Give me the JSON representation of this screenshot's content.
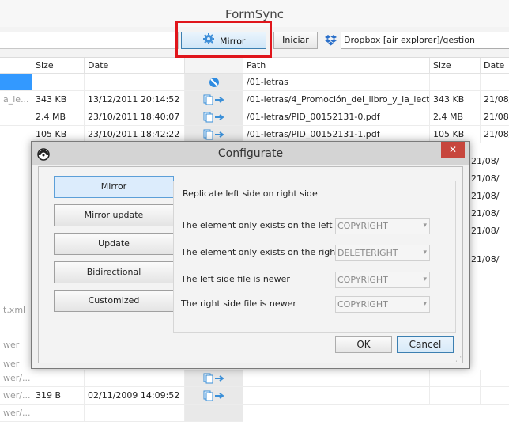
{
  "app": {
    "title": "FormSync"
  },
  "toolbar": {
    "mirror_label": "Mirror",
    "iniciar_label": "Iniciar",
    "right_path": "Dropbox [air explorer]/gestion"
  },
  "grid": {
    "left_headers": [
      "Size",
      "Date"
    ],
    "right_headers": [
      "Path",
      "Size",
      "Date"
    ],
    "rows": [
      {
        "left_name": "",
        "left_size": "",
        "left_date": "",
        "path": "/01-letras",
        "right_size": "",
        "right_date": "",
        "action": "skip"
      },
      {
        "left_name": "a_le...",
        "left_size": "343 KB",
        "left_date": "13/12/2011 20:14:52",
        "path": "/01-letras/4_Promoción_del_libro_y_la_lectur...",
        "right_size": "343 KB",
        "right_date": "21/08/",
        "action": "copy"
      },
      {
        "left_name": "",
        "left_size": "2,4 MB",
        "left_date": "23/10/2011 18:40:07",
        "path": "/01-letras/PID_00152131-0.pdf",
        "right_size": "2,4 MB",
        "right_date": "21/08/",
        "action": "copy"
      },
      {
        "left_name": "",
        "left_size": "105 KB",
        "left_date": "23/10/2011 18:42:22",
        "path": "/01-letras/PID_00152131-1.pdf",
        "right_size": "105 KB",
        "right_date": "21/08/",
        "action": "copy"
      }
    ],
    "partial_right_dates": [
      "21/08/",
      "21/08/",
      "21/08/",
      "21/08/",
      "21/08/",
      "21/08/"
    ],
    "partial_left_texts": [
      "t.xml",
      "wer",
      "wer",
      "wer/...",
      "wer/..."
    ],
    "bottom_row": {
      "left_name": "wer/...",
      "left_size": "319 B",
      "left_date": "02/11/2009 14:09:52"
    }
  },
  "dialog": {
    "title": "Configurate",
    "close_label": "✕",
    "mode_buttons": [
      "Mirror",
      "Mirror update",
      "Update",
      "Bidirectional",
      "Customized"
    ],
    "active_mode": "Mirror",
    "description": "Replicate left side on right side",
    "settings": [
      {
        "label": "The element only exists on the left side:",
        "value": "COPYRIGHT"
      },
      {
        "label": "The element only exists on the right side:",
        "value": "DELETERIGHT"
      },
      {
        "label": "The left side file is newer",
        "value": "COPYRIGHT"
      },
      {
        "label": "The right side file is newer",
        "value": "COPYRIGHT"
      }
    ],
    "ok_label": "OK",
    "cancel_label": "Cancel"
  },
  "colors": {
    "selection": "#3399ff",
    "highlight_border": "#e0151b",
    "close_button": "#c7463d",
    "copy_arrow": "#3a8fd8"
  }
}
